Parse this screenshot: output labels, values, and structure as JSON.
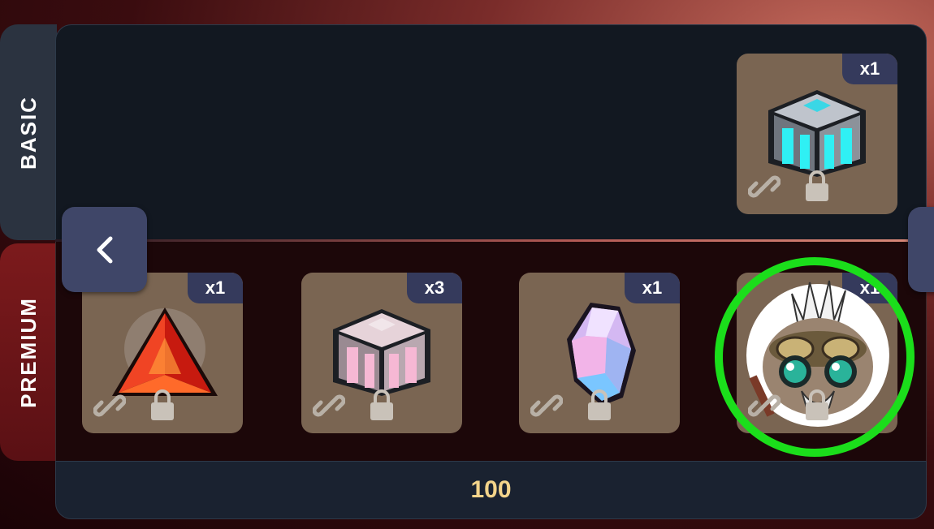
{
  "tabs": {
    "basic": "BASIC",
    "premium": "PREMIUM"
  },
  "basic_items": [
    {
      "name": "cyan-crate",
      "quantity": "x1"
    }
  ],
  "premium_items": [
    {
      "name": "red-pyramid",
      "quantity": "x1"
    },
    {
      "name": "pink-crate",
      "quantity": "x3"
    },
    {
      "name": "crystal-gem",
      "quantity": "x1"
    },
    {
      "name": "character-avatar",
      "quantity": "x1"
    }
  ],
  "footer": {
    "value": "100"
  },
  "colors": {
    "highlight": "#1bde1b",
    "badge": "#353a5c",
    "card": "#7a6552",
    "footer_text": "#f3d48a"
  }
}
